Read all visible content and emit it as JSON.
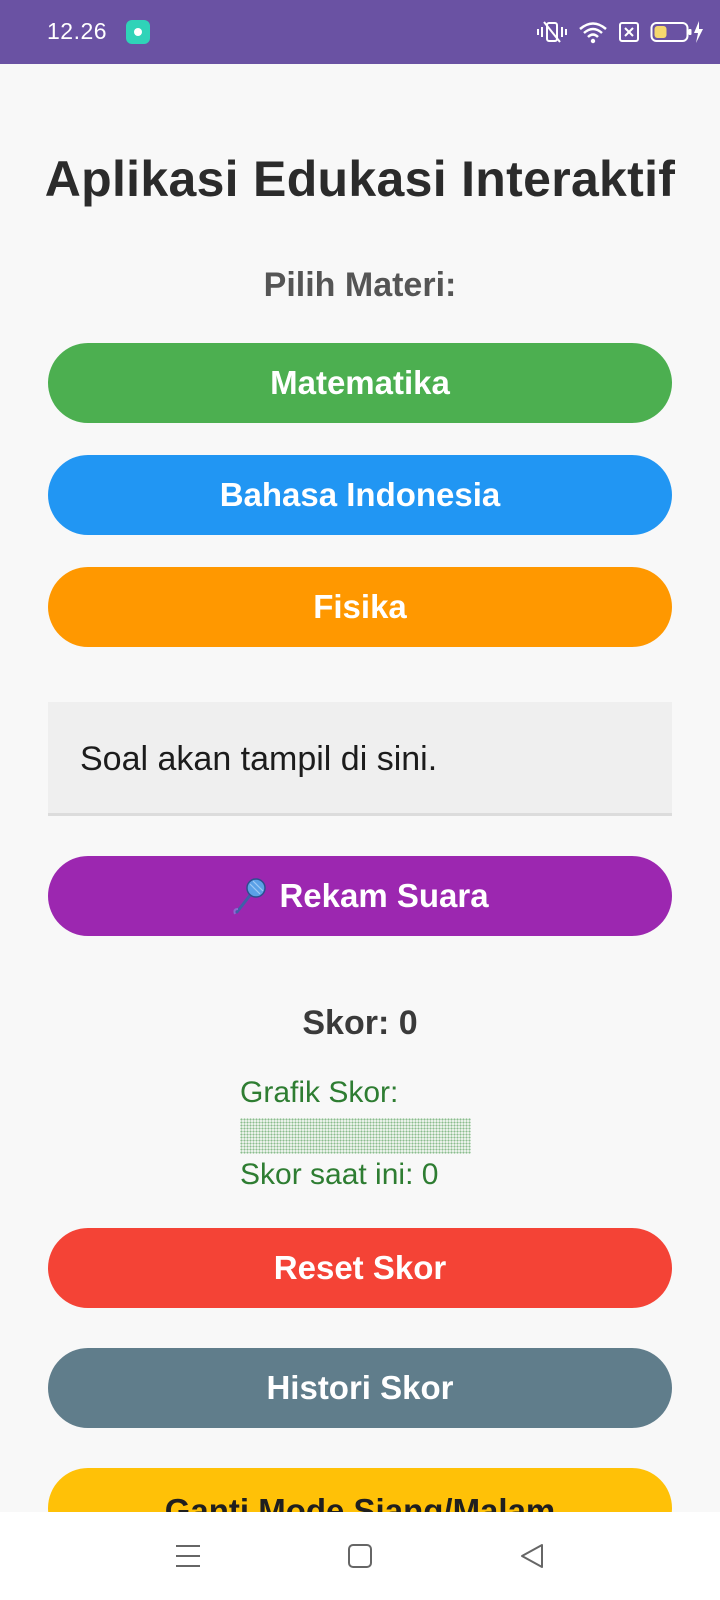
{
  "status_bar": {
    "time": "12.26",
    "color": "#6a52a3",
    "icons": [
      "app-notification-icon",
      "vibrate-icon",
      "wifi-icon",
      "no-sim-icon",
      "battery-charging-icon"
    ]
  },
  "app": {
    "title": "Aplikasi Edukasi Interaktif",
    "select_label": "Pilih Materi:",
    "subjects": [
      {
        "label": "Matematika",
        "color": "#4caf50"
      },
      {
        "label": "Bahasa Indonesia",
        "color": "#2196f3"
      },
      {
        "label": "Fisika",
        "color": "#ff9800"
      }
    ],
    "question_text": "Soal akan tampil di sini.",
    "record_button": {
      "icon": "microphone-icon",
      "label": "Rekam Suara",
      "color": "#9c27b0"
    },
    "score_label": "Skor: 0",
    "chart": {
      "title": "Grafik Skor:",
      "current_label": "Skor saat ini: 0",
      "score_fraction": 0
    },
    "reset_button": {
      "label": "Reset Skor",
      "color": "#f44336"
    },
    "history_button": {
      "label": "Histori Skor",
      "color": "#607d8b"
    },
    "mode_button": {
      "label": "Ganti Mode Siang/Malam",
      "color": "#ffc107"
    }
  },
  "nav_bar": {
    "icons": [
      "menu-icon",
      "home-icon",
      "back-icon"
    ]
  }
}
